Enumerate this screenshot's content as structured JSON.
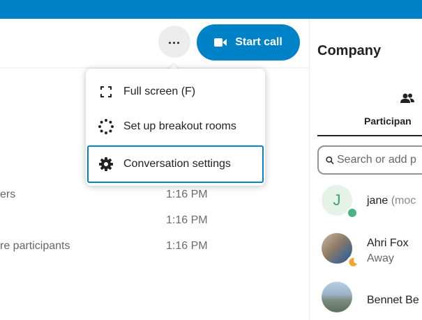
{
  "header": {
    "more_label": "...",
    "start_call_label": "Start call"
  },
  "menu": {
    "items": [
      {
        "label": "Full screen (F)",
        "icon": "fullscreen-icon"
      },
      {
        "label": "Set up breakout rooms",
        "icon": "breakout-rooms-icon"
      },
      {
        "label": "Conversation settings",
        "icon": "gear-icon"
      }
    ]
  },
  "messages": [
    {
      "text": "ers",
      "time": "1:16 PM"
    },
    {
      "text": "",
      "time": "1:16 PM"
    },
    {
      "text": "re participants",
      "time": "1:16 PM"
    }
  ],
  "sidebar": {
    "title": "Company",
    "tab_label": "Participan",
    "tab_icon": "participants-icon",
    "search_placeholder": "Search or add p",
    "participants": [
      {
        "initial": "J",
        "name": "jane",
        "role": "(moc",
        "status": "",
        "presence": "online",
        "presence_color": "#49b382"
      },
      {
        "name": "Ahri Fox",
        "status": "Away",
        "presence": "away",
        "presence_color": "#f4a331"
      },
      {
        "name": "Bennet Be",
        "status": "",
        "presence": "",
        "presence_color": ""
      }
    ]
  },
  "colors": {
    "brand": "#0082c9",
    "online": "#49b382",
    "away": "#f4a331"
  }
}
